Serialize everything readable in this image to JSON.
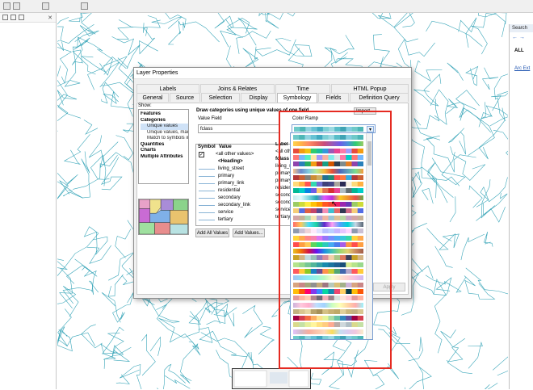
{
  "app": {
    "search_panel_title": "Search",
    "search_nav": "← →",
    "search_all": "ALL",
    "search_link": "Arc Ext"
  },
  "dialog": {
    "title": "Layer Properties",
    "tabs_row1": [
      "Labels",
      "Joins & Relates",
      "Time",
      "HTML Popup"
    ],
    "tabs_row2": [
      "General",
      "Source",
      "Selection",
      "Display",
      "Symbology",
      "Fields",
      "Definition Query"
    ],
    "active_tab": "Symbology",
    "show_label": "Show:",
    "show_tree": [
      {
        "label": "Features",
        "bold": true,
        "sub": false
      },
      {
        "label": "Categories",
        "bold": true,
        "sub": false
      },
      {
        "label": "Unique values",
        "bold": false,
        "sub": true,
        "selected": true
      },
      {
        "label": "Unique values, many",
        "bold": false,
        "sub": true
      },
      {
        "label": "Match to symbols in a",
        "bold": false,
        "sub": true
      },
      {
        "label": "Quantities",
        "bold": true,
        "sub": false
      },
      {
        "label": "Charts",
        "bold": true,
        "sub": false
      },
      {
        "label": "Multiple Attributes",
        "bold": true,
        "sub": false
      }
    ],
    "draw_header": "Draw categories using unique values of one field.",
    "import_label": "Import...",
    "value_field_label": "Value Field",
    "value_field": "fclass",
    "color_ramp_label": "Color Ramp",
    "table": {
      "col_symbol": "Symbol",
      "col_value": "Value",
      "col_label": "Label",
      "rows": [
        {
          "value": "<all other values>",
          "label": "<all othe"
        },
        {
          "value": "<Heading>",
          "label": "fclass"
        },
        {
          "value": "living_street",
          "label": "living_st"
        },
        {
          "value": "primary",
          "label": "primary"
        },
        {
          "value": "primary_link",
          "label": "primary_"
        },
        {
          "value": "residential",
          "label": "residentia"
        },
        {
          "value": "secondary",
          "label": "secondar"
        },
        {
          "value": "secondary_link",
          "label": "secondar"
        },
        {
          "value": "service",
          "label": "service"
        },
        {
          "value": "tertiary",
          "label": "tertiary"
        }
      ]
    },
    "add_all_label": "Add All Values",
    "add_values_label": "Add Values...",
    "apply_label": "Apply"
  },
  "colors": {
    "accent": "#e52a21",
    "map_lines": "#3aa6b9"
  }
}
